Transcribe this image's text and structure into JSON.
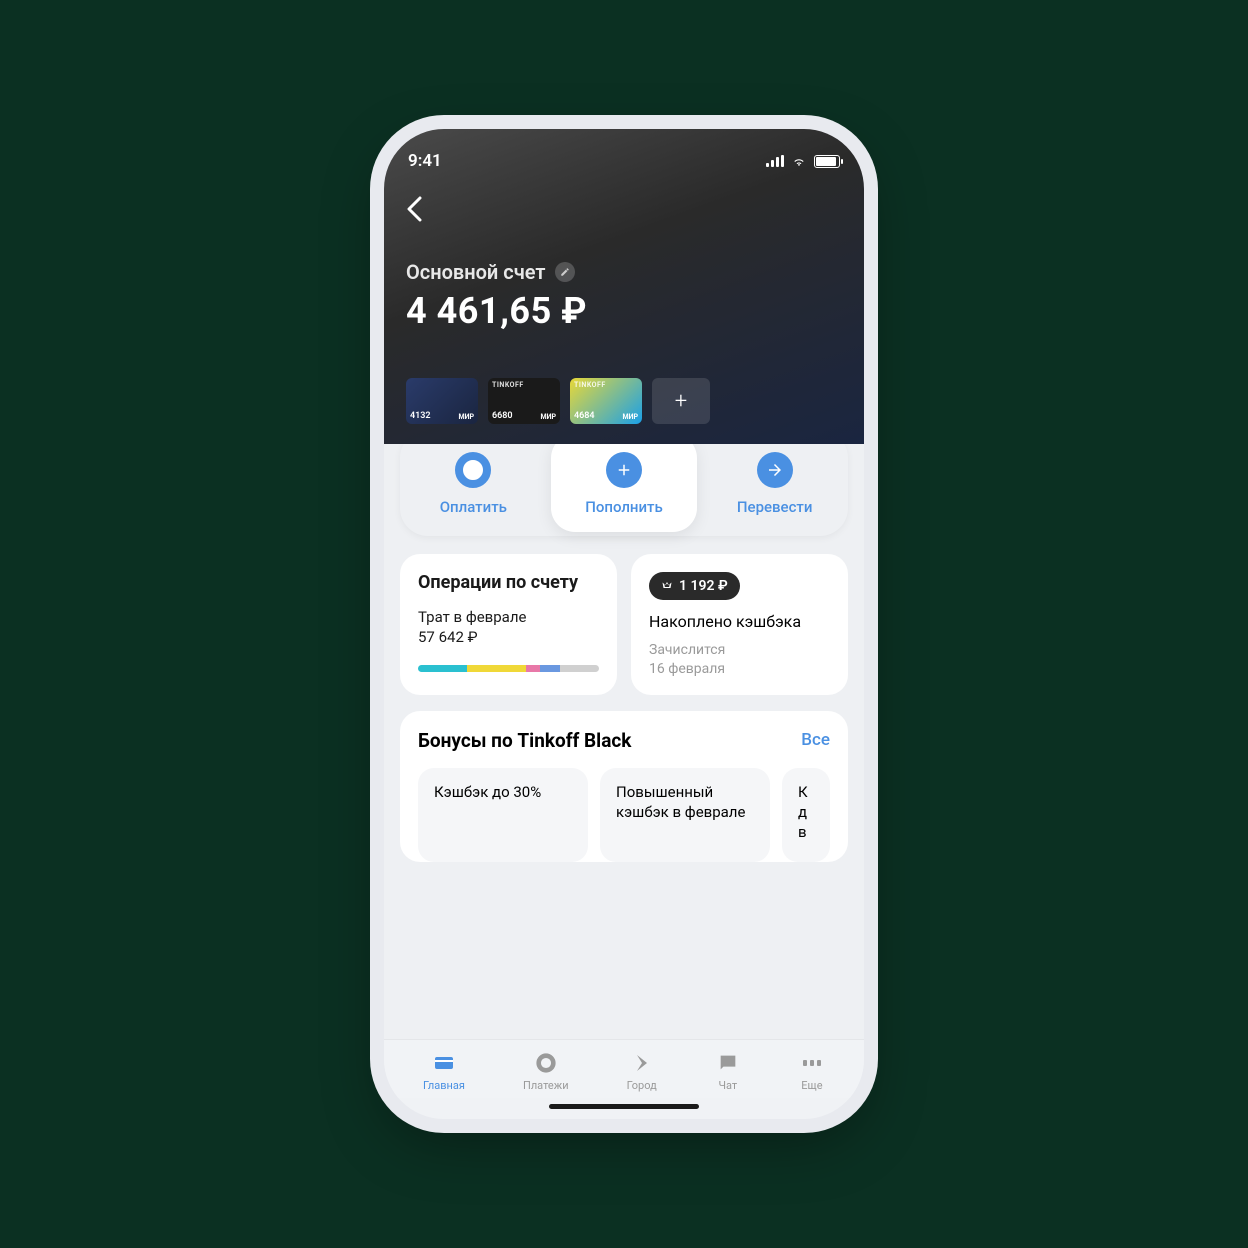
{
  "status": {
    "time": "9:41"
  },
  "account": {
    "name": "Основной счет",
    "balance": "4 461,65 ₽"
  },
  "cards": [
    {
      "last4": "4132",
      "system": "МИР",
      "brand": ""
    },
    {
      "last4": "6680",
      "system": "МИР",
      "brand": "TINKOFF"
    },
    {
      "last4": "4684",
      "system": "МИР",
      "brand": "TINKOFF"
    }
  ],
  "actions": {
    "pay": "Оплатить",
    "topup": "Пополнить",
    "transfer": "Перевести"
  },
  "operations": {
    "title": "Операции по счету",
    "sub_line1": "Трат в феврале",
    "sub_line2": "57 642 ₽"
  },
  "cashback": {
    "badge": "1 192 ₽",
    "title": "Накоплено кэшбэка",
    "meta_line1": "Зачислится",
    "meta_line2": "16 февраля"
  },
  "bonuses": {
    "title": "Бонусы по Tinkoff Black",
    "all": "Все",
    "cards": [
      "Кэшбэк до 30%",
      "Повышенный кэшбэк в феврале",
      "К д в"
    ]
  },
  "tabs": {
    "home": "Главная",
    "payments": "Платежи",
    "city": "Город",
    "chat": "Чат",
    "more": "Еще"
  }
}
